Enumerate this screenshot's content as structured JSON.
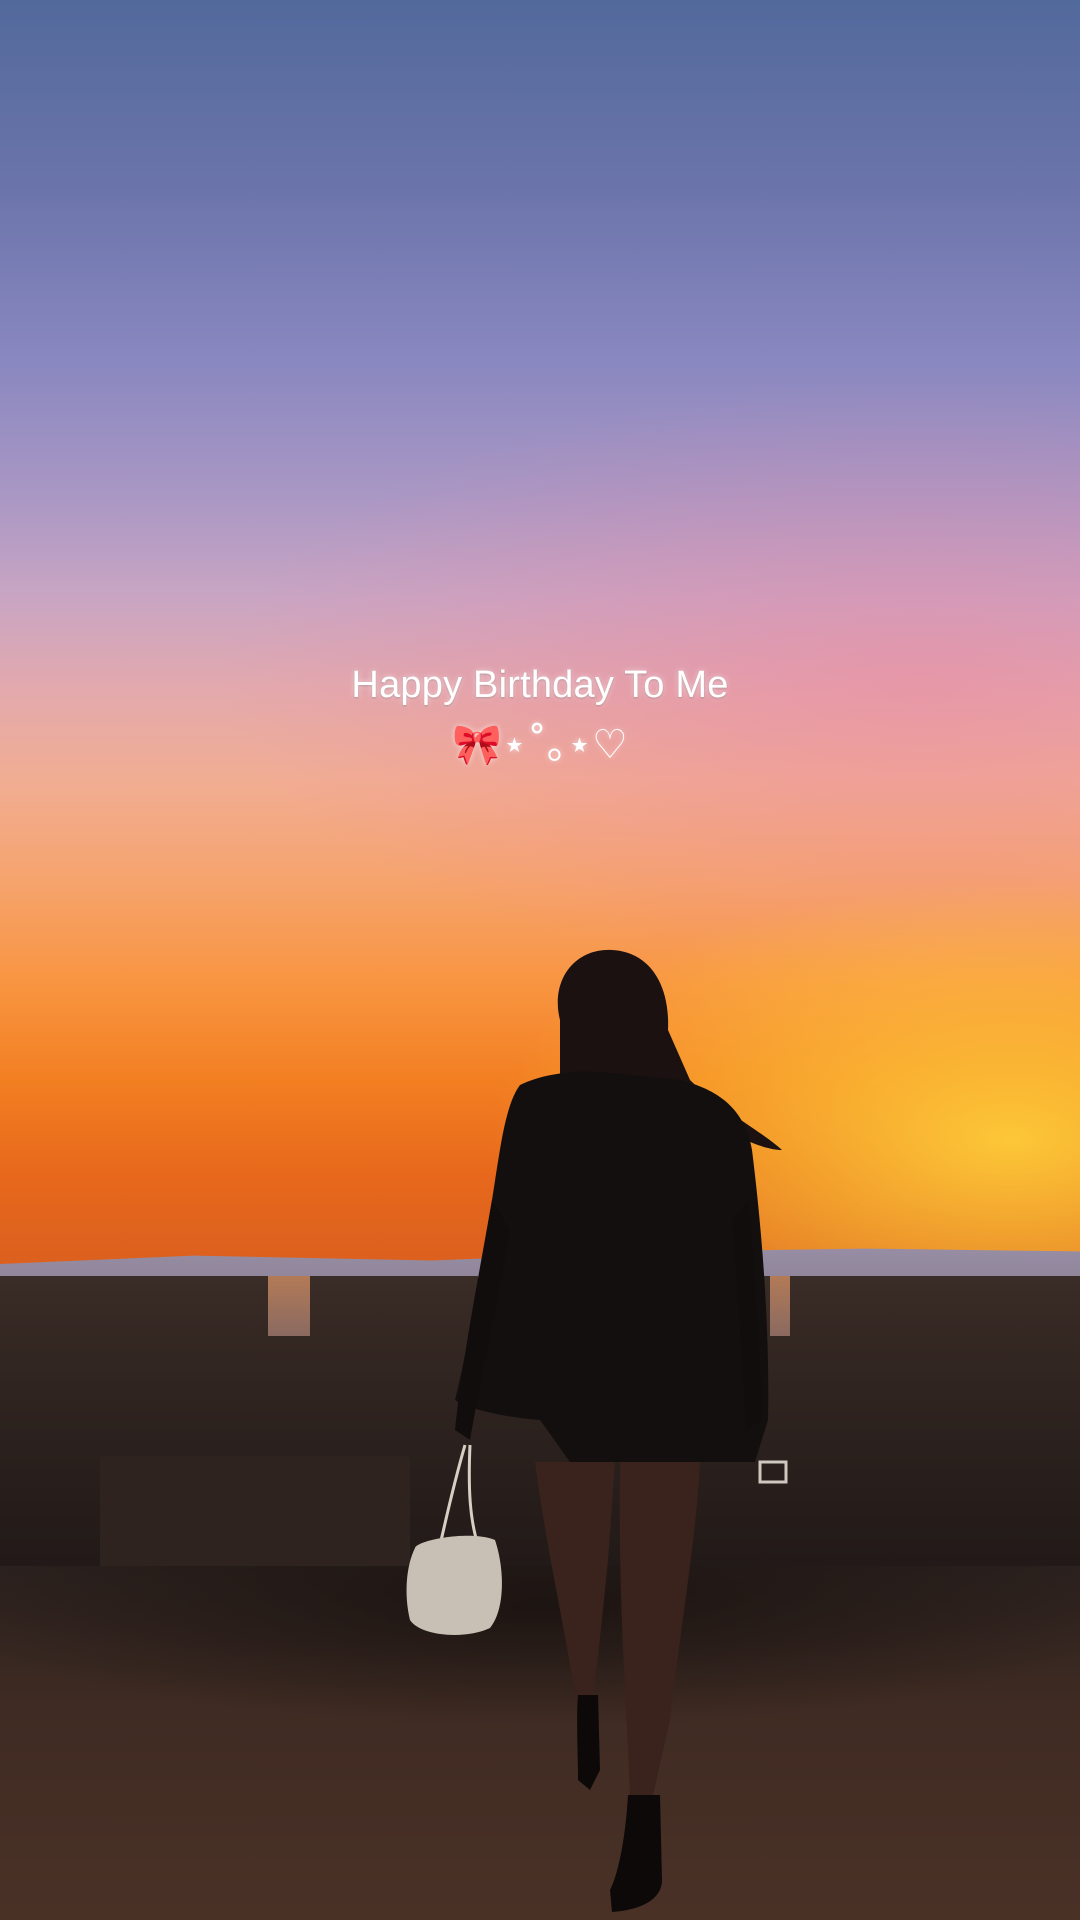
{
  "caption": {
    "title": "Happy Birthday To Me",
    "decoration": "🎀⋆˚｡⋆♡"
  },
  "scene": {
    "description_icon": "sunset-silhouette-photo",
    "colors": {
      "sky_top": "#52699c",
      "sky_mid": "#e3a9ad",
      "sky_horizon": "#f37f22",
      "silhouette": "#140f0f",
      "ground": "#4a3126"
    }
  }
}
